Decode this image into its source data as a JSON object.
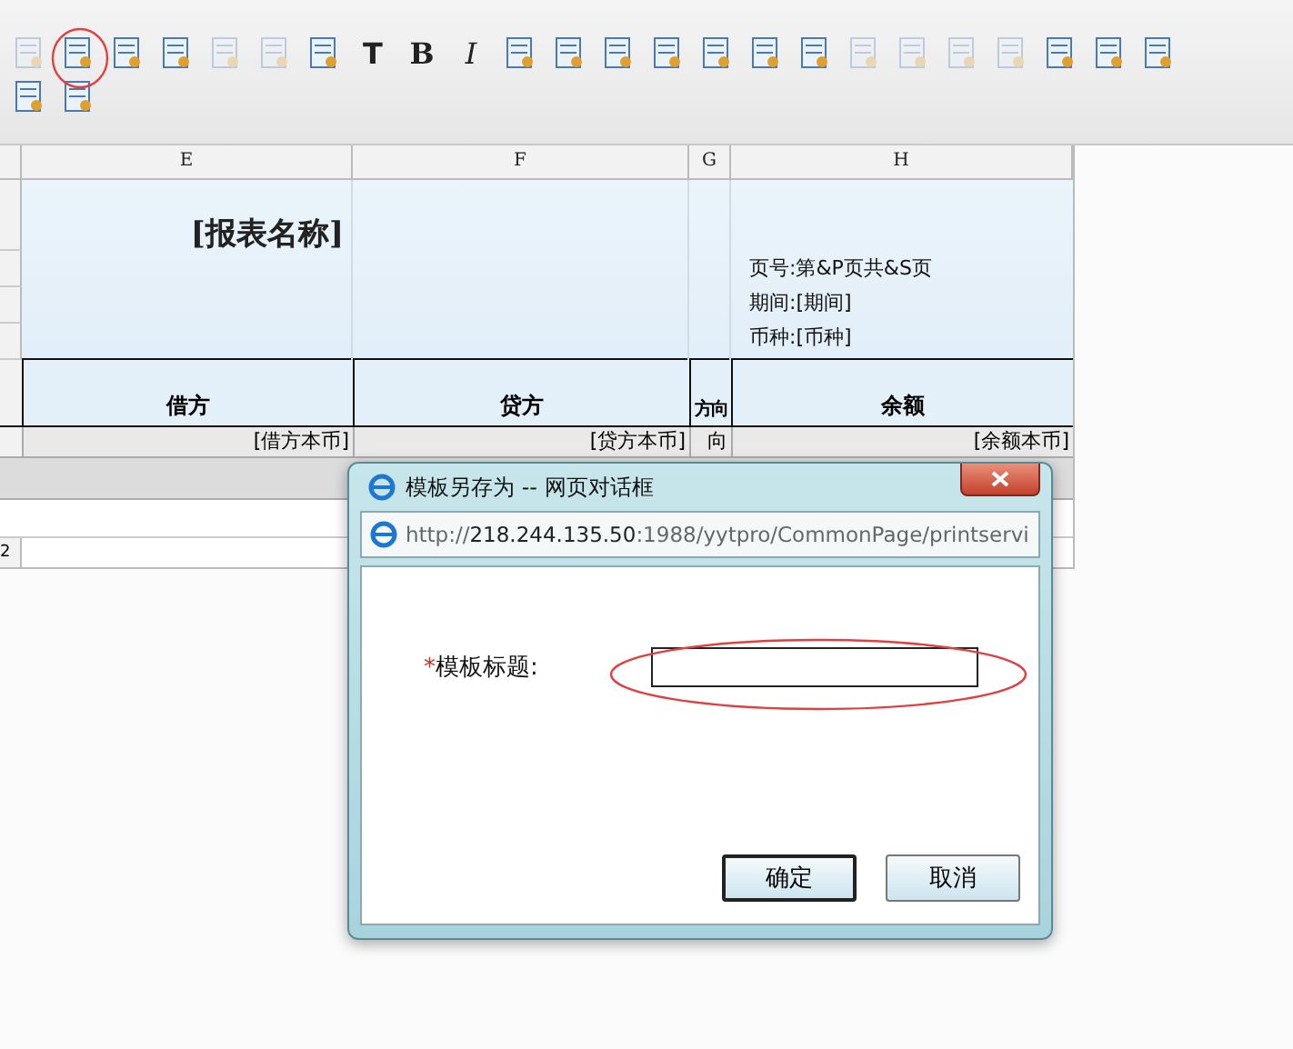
{
  "toolbar_rows": [
    [
      {
        "kind": "icon",
        "disabled": true
      },
      {
        "kind": "icon",
        "disabled": false
      },
      {
        "kind": "icon",
        "disabled": false
      },
      {
        "kind": "icon",
        "disabled": false
      },
      {
        "kind": "icon",
        "disabled": true
      },
      {
        "kind": "icon",
        "disabled": true
      },
      {
        "kind": "icon",
        "disabled": false
      },
      {
        "kind": "glyph",
        "text": "T",
        "disabled": false
      },
      {
        "kind": "glyph",
        "text": "B",
        "disabled": false
      },
      {
        "kind": "glyph",
        "text": "I",
        "disabled": false
      },
      {
        "kind": "icon",
        "disabled": false
      },
      {
        "kind": "icon",
        "disabled": false
      },
      {
        "kind": "icon",
        "disabled": false
      },
      {
        "kind": "icon",
        "disabled": false
      },
      {
        "kind": "icon",
        "disabled": false
      },
      {
        "kind": "icon",
        "disabled": false
      },
      {
        "kind": "icon",
        "disabled": false
      },
      {
        "kind": "icon",
        "disabled": true
      },
      {
        "kind": "icon",
        "disabled": true
      },
      {
        "kind": "icon",
        "disabled": true
      },
      {
        "kind": "icon",
        "disabled": true
      },
      {
        "kind": "icon",
        "disabled": false
      },
      {
        "kind": "icon",
        "disabled": false
      },
      {
        "kind": "icon",
        "disabled": false
      }
    ],
    [
      {
        "kind": "icon",
        "disabled": false
      },
      {
        "kind": "icon",
        "disabled": false
      }
    ]
  ],
  "sheet": {
    "columns": [
      "E",
      "F",
      "G",
      "H"
    ],
    "title": "[报表名称]",
    "info_lines": [
      "页号:第&P页共&S页",
      "期间:[期间]",
      "币种:[币种]"
    ],
    "headers": [
      "借方",
      "贷方",
      "方向",
      "余额"
    ],
    "data_row": [
      "[借方本币]",
      "[贷方本币]",
      "向",
      "[余额本币]"
    ],
    "row_number": "2"
  },
  "dialog": {
    "title": "模板另存为 -- 网页对话框",
    "url": "http://**218.244.135.50**:1988/yytpro/CommonPage/printservi",
    "required_mark": "*",
    "label": "模板标题:",
    "buttons": [
      {
        "label": "确定",
        "default": true
      },
      {
        "label": "取消",
        "default": false
      }
    ]
  }
}
